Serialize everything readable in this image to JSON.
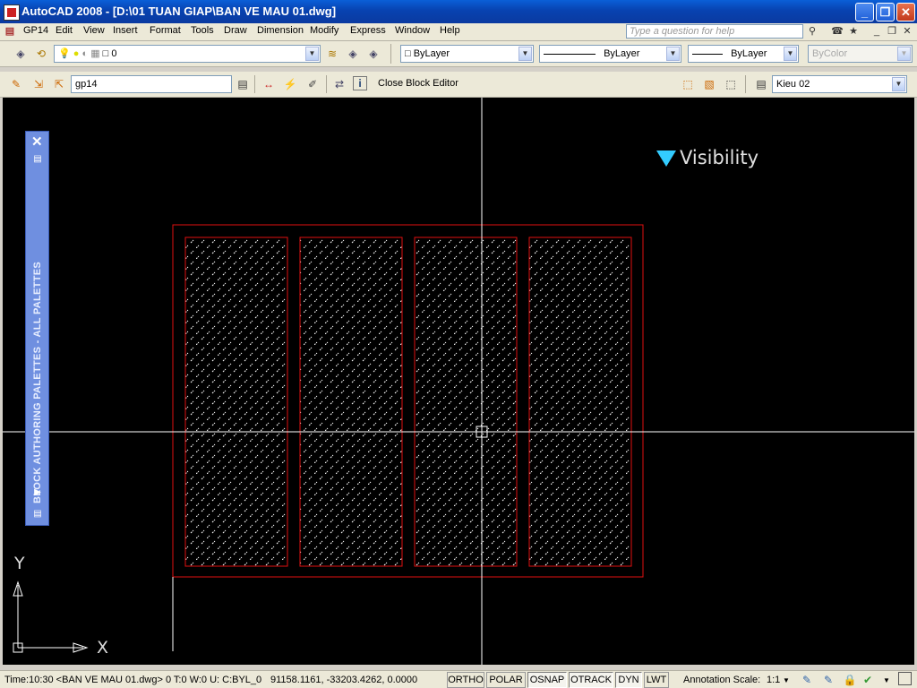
{
  "window": {
    "title": "AutoCAD 2008 - [D:\\01 TUAN GIAP\\BAN VE MAU 01.dwg]",
    "minimize_icon": "minimize-icon",
    "maximize_icon": "restore-icon",
    "close_icon": "close-icon"
  },
  "menubar": {
    "items": [
      "GP14",
      "Edit",
      "View",
      "Insert",
      "Format",
      "Tools",
      "Draw",
      "Dimension",
      "Modify",
      "Express",
      "Window",
      "Help"
    ],
    "help_placeholder": "Type a question for help"
  },
  "layers_toolbar": {
    "layer_value": "0",
    "color_value": "ByLayer",
    "linetype_value": "ByLayer",
    "lineweight_value": "ByLayer",
    "plotstyle_value": "ByColor"
  },
  "block_editor_toolbar": {
    "block_name": "gp14",
    "close_label": "Close Block Editor",
    "visibility_state": "Kieu 02"
  },
  "palette": {
    "title": "BLOCK AUTHORING PALETTES - ALL PALETTES"
  },
  "drawing": {
    "visibility_label": "Visibility",
    "ucs_x": "X",
    "ucs_y": "Y",
    "colors": {
      "background": "#000000",
      "outline": "#e01010",
      "hatch": "#ffffff",
      "crosshair": "#ffffff",
      "grip": "#33ccff"
    }
  },
  "statusbar": {
    "info": "Time:10:30 <BAN VE MAU 01.dwg>  0 T:0 W:0 U: C:BYL_0",
    "coordinates": "91158.1161, -33203.4262, 0.0000",
    "modes": [
      "ORTHO",
      "POLAR",
      "OSNAP",
      "OTRACK",
      "DYN",
      "LWT"
    ],
    "annotation_label": "Annotation Scale:",
    "annotation_value": "1:1"
  }
}
